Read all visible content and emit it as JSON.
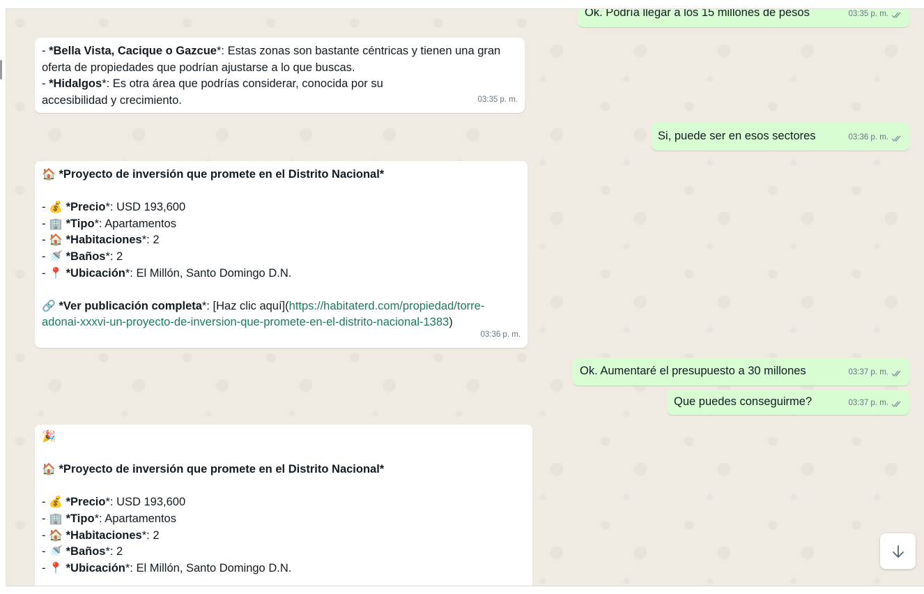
{
  "messages": [
    {
      "time": "03:35 p. m.",
      "text": "Ok. Podría llegar a los 15 millones de pesos"
    },
    {
      "time": "03:35 p. m.",
      "lines": [
        {
          "pre": "- ",
          "bold": "*Bella Vista, Cacique o Gazcue",
          "post": "*: Estas zonas son bastante céntricas y tienen una gran"
        },
        {
          "pre": "oferta de propiedades que podrían ajustarse a lo que buscas.",
          "bold": "",
          "post": ""
        },
        {
          "pre": "- ",
          "bold": "*Hidalgos",
          "post": "*: Es otra área que podrías considerar, conocida por su"
        },
        {
          "pre": "accesibilidad y crecimiento.",
          "bold": "",
          "post": ""
        }
      ]
    },
    {
      "time": "03:36 p. m.",
      "text": "Si, puede ser en esos sectores"
    },
    {
      "time": "03:36 p. m.",
      "title_emoji": "🏠",
      "title": "*Proyecto de inversión que promete en el Distrito Nacional*",
      "items": [
        {
          "emoji": "💰",
          "label": "*Precio",
          "value": "*: USD 193,600"
        },
        {
          "emoji": "🏢",
          "label": "*Tipo",
          "value": "*: Apartamentos"
        },
        {
          "emoji": "🏠",
          "label": "*Habitaciones",
          "value": "*: 2"
        },
        {
          "emoji": "🚿",
          "label": "*Baños",
          "value": "*: 2"
        },
        {
          "emoji": "📍",
          "label": "*Ubicación",
          "value": "*: El Millón, Santo Domingo D.N."
        }
      ],
      "link_emoji": "🔗",
      "link_label": "*Ver publicación completa",
      "link_mid": "*: [Haz clic aquí](",
      "link_url_1": "https://habitaterd.com/propiedad/torre-",
      "link_url_2": "adonai-xxxvi-un-proyecto-de-inversion-que-promete-en-el-distrito-nacional-1383",
      "link_end": ")"
    },
    {
      "time": "03:37 p. m.",
      "text": "Ok. Aumentaré el presupuesto a 30 millones"
    },
    {
      "time": "03:37 p. m.",
      "text": "Que puedes conseguirme?"
    },
    {
      "party_emoji": "🎉",
      "title_emoji": "🏠",
      "title": "*Proyecto de inversión que promete en el Distrito Nacional*",
      "items": [
        {
          "emoji": "💰",
          "label": "*Precio",
          "value": "*: USD 193,600"
        },
        {
          "emoji": "🏢",
          "label": "*Tipo",
          "value": "*: Apartamentos"
        },
        {
          "emoji": "🏠",
          "label": "*Habitaciones",
          "value": "*: 2"
        },
        {
          "emoji": "🚿",
          "label": "*Baños",
          "value": "*: 2"
        },
        {
          "emoji": "📍",
          "label": "*Ubicación",
          "value": "*: El Millón, Santo Domingo D.N."
        }
      ]
    }
  ],
  "scroll_down_icon": "arrow-down-icon",
  "colors": {
    "incoming": "#ffffff",
    "outgoing": "#d9fdd3",
    "background": "#efeae2",
    "link": "#1b7a5c"
  }
}
